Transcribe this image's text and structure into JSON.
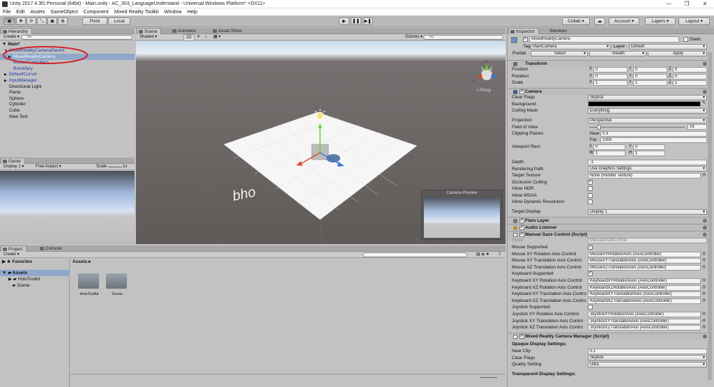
{
  "window": {
    "title": "Unity 2017.4.3f1 Personal (64bit) - Main.unity - AC_303_LanguageUnderstand - Universal Windows Platform* <DX11>",
    "minimize": "—",
    "maximize": "❐",
    "close": "✕"
  },
  "menu": [
    "File",
    "Edit",
    "Assets",
    "GameObject",
    "Component",
    "Mixed Reality Toolkit",
    "Window",
    "Help"
  ],
  "toolbar": {
    "pivot": "Pivot",
    "local": "Local",
    "collab": "Collab",
    "account": "Account",
    "layers": "Layers",
    "layout": "Layout",
    "play": "▶",
    "pause": "❚❚",
    "step": "▶❚"
  },
  "hierarchy": {
    "tab": "Hierarchy",
    "create": "Create",
    "search_placeholder": "All",
    "scene": "Main*",
    "items": [
      {
        "label": "MixedRealityCameraParent",
        "indent": 1,
        "arrow": "▼",
        "color": "blue"
      },
      {
        "label": "MixedRealityCamera",
        "indent": 2,
        "arrow": "▶",
        "color": "selected"
      },
      {
        "label": "MotionControllers",
        "indent": 2,
        "arrow": "",
        "color": "blue"
      },
      {
        "label": "Boundary",
        "indent": 2,
        "arrow": "",
        "color": "blue"
      },
      {
        "label": "DefaultCursor",
        "indent": 1,
        "arrow": "▶",
        "color": "blue"
      },
      {
        "label": "InputManager",
        "indent": 1,
        "arrow": "▶",
        "color": "blue"
      },
      {
        "label": "Directional Light",
        "indent": 1,
        "arrow": "",
        "color": "black"
      },
      {
        "label": "Plane",
        "indent": 1,
        "arrow": "",
        "color": "black"
      },
      {
        "label": "Sphere",
        "indent": 1,
        "arrow": "",
        "color": "black"
      },
      {
        "label": "Cylinder",
        "indent": 1,
        "arrow": "",
        "color": "black"
      },
      {
        "label": "Cube",
        "indent": 1,
        "arrow": "",
        "color": "black"
      },
      {
        "label": "New Text",
        "indent": 1,
        "arrow": "",
        "color": "black"
      }
    ]
  },
  "game": {
    "tab": "Game",
    "display": "Display 1",
    "aspect": "Free Aspect",
    "scale_label": "Scale",
    "scale_value": "1x"
  },
  "scene": {
    "tabs": [
      "Scene",
      "Animator",
      "Asset Store"
    ],
    "shading": "Shaded",
    "mode_2d": "2D",
    "gizmos": "Gizmos",
    "search_placeholder": "All",
    "persp": "< Persp",
    "text3d": "bho",
    "camera_preview": "Camera Preview",
    "gizmo_x": "x",
    "gizmo_y": "y",
    "gizmo_z": "z"
  },
  "project": {
    "tabs": [
      "Project",
      "Console"
    ],
    "create": "Create",
    "favorites": "Favorites",
    "assets": "Assets",
    "tree": [
      "HoloToolkit",
      "Scene"
    ],
    "breadcrumb": "Assets ▸",
    "folders": [
      "HoloToolkit",
      "Scene"
    ],
    "count": "9"
  },
  "inspector": {
    "tabs": [
      "Inspector",
      "Services"
    ],
    "name": "MixedRealityCamera",
    "static": "Static",
    "tag_label": "Tag",
    "tag": "MainCamera",
    "layer_label": "Layer",
    "layer": "Default",
    "prefab_label": "Prefab",
    "select": "Select",
    "revert": "Revert",
    "apply": "Apply",
    "transform": {
      "title": "Transform",
      "rows": [
        {
          "label": "Position",
          "x": "0",
          "y": "0",
          "z": "0"
        },
        {
          "label": "Rotation",
          "x": "0",
          "y": "0",
          "z": "0"
        },
        {
          "label": "Scale",
          "x": "1",
          "y": "1",
          "z": "1"
        }
      ]
    },
    "camera": {
      "title": "Camera",
      "clear_flags_label": "Clear Flags",
      "clear_flags": "Skybox",
      "background_label": "Background",
      "culling_label": "Culling Mask",
      "culling": "Everything",
      "projection_label": "Projection",
      "projection": "Perspective",
      "fov_label": "Field of View",
      "fov": "16",
      "fov_fraction": 0.1,
      "clipping_label": "Clipping Planes",
      "near_label": "Near",
      "near": "0.3",
      "far_label": "Far",
      "far": "1000",
      "viewport_label": "Viewport Rect",
      "vx": "0",
      "vy": "0",
      "vw": "1",
      "vh": "1",
      "depth_label": "Depth",
      "depth": "-1",
      "rendering_label": "Rendering Path",
      "rendering": "Use Graphics Settings",
      "target_tex_label": "Target Texture",
      "target_tex": "None (Render Texture)",
      "occlusion_label": "Occlusion Culling",
      "occlusion": true,
      "hdr_label": "Allow HDR",
      "hdr": false,
      "msaa_label": "Allow MSAA",
      "msaa": false,
      "dynres_label": "Allow Dynamic Resolution",
      "dynres": false,
      "target_display_label": "Target Display",
      "target_display": "Display 1"
    },
    "flare": "Flare Layer",
    "audio": "Audio Listener",
    "manual_gaze": {
      "title": "Manual Gaze Control (Script)",
      "script_label": "Script",
      "script": "ManualGazeControl",
      "rows": [
        {
          "label": "Mouse Supported",
          "type": "check",
          "value": true
        },
        {
          "label": "Mouse XY Rotation Axis Control",
          "type": "obj",
          "value": "MouseXYRotationAxis (AxisController)"
        },
        {
          "label": "Mouse XY Translation Axis Control",
          "type": "obj",
          "value": "MouseXYTranslationAxis (AxisController)"
        },
        {
          "label": "Mouse XZ Translation Axis Control",
          "type": "obj",
          "value": "MouseXZTranslationAxis (AxisController)"
        },
        {
          "label": "Keyboard Supported",
          "type": "check",
          "value": true
        },
        {
          "label": "Keyboard XY Rotation Axis Control",
          "type": "obj",
          "value": "KeyboardXYRotationAxis (AxisController)"
        },
        {
          "label": "Keyboard XZ Rotation Axis Control",
          "type": "obj",
          "value": "KeyboardXZRotationAxis (AxisController)"
        },
        {
          "label": "Keyboard XY Translation Axis Contro",
          "type": "obj",
          "value": "KeyboardXYTranslationAxis (AxisController)"
        },
        {
          "label": "Keyboard XZ Translation Axis Contro",
          "type": "obj",
          "value": "KeyboardXZTranslationAxis (AxisController)"
        },
        {
          "label": "Joystick Supported",
          "type": "check",
          "value": false
        },
        {
          "label": "Joystick XY Rotation Axis Control",
          "type": "obj",
          "value": "JoystickXYRotationAxis (AxisController)"
        },
        {
          "label": "Joystick XY Translation Axis Contro",
          "type": "obj",
          "value": "JoystickXYTranslationAxis (AxisController)"
        },
        {
          "label": "Joystick XZ Translation Axis Contro",
          "type": "obj",
          "value": "JoystickXZTranslationAxis (AxisController)"
        }
      ]
    },
    "mr_camera": {
      "title": "Mixed Reality Camera Manager (Script)",
      "opaque": "Opaque Display Settings:",
      "near_clip_label": "Near Clip",
      "near_clip": "0.1",
      "clear_flags_label": "Clear Flags",
      "clear_flags": "Skybox",
      "quality_label": "Quality Setting",
      "quality": "Ultra",
      "transparent": "Transparent Display Settings:"
    }
  },
  "colors": {
    "selection": "#8fa7cc",
    "annotation": "#d3232a",
    "hier_blue": "#1d3aa8",
    "scene_bg": "#686260"
  }
}
